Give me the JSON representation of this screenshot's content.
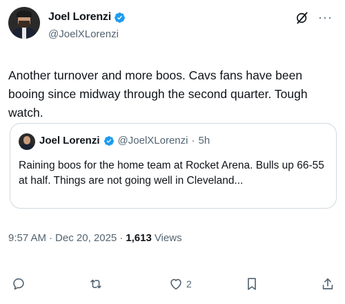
{
  "author": {
    "name": "Joel Lorenzi",
    "handle": "@JoelXLorenzi"
  },
  "icons": {
    "verified": "verified-badge-icon",
    "grok": "grok-icon",
    "more": "more-icon"
  },
  "colors": {
    "verified": "#1d9bf0",
    "secondary_text": "#536471",
    "primary_text": "#0f1419",
    "border": "#cfd9de"
  },
  "tweet": {
    "text": "Another turnover and more boos. Cavs fans have been booing since midway through the second quarter. Tough watch."
  },
  "quote": {
    "name": "Joel Lorenzi",
    "handle": "@JoelXLorenzi",
    "dot": "·",
    "time": "5h",
    "text": "Raining boos for the home team at Rocket Arena. Bulls up 66-55 at half. Things are not going well in Cleveland..."
  },
  "meta": {
    "time": "9:57 AM",
    "sep1": "·",
    "date": "Dec 20, 2025",
    "sep2": "·",
    "views_count": "1,613",
    "views_label": "Views"
  },
  "actions": {
    "reply_count": "",
    "repost_count": "",
    "like_count": "2",
    "more_symbol": "···"
  }
}
